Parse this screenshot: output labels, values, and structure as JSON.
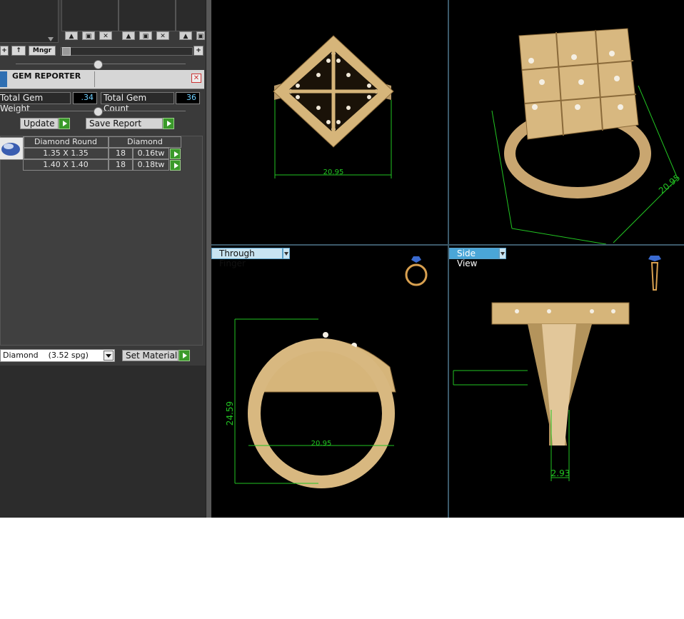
{
  "toolbar": {
    "mngr_label": "Mngr",
    "plus_label": "+",
    "slot_buttons": [
      "up-arrow",
      "save-icon",
      "delete-icon"
    ]
  },
  "gem_reporter": {
    "title": "GEM REPORTER",
    "total_weight_label": "Total Gem Weight",
    "total_weight_value": ".34",
    "total_count_label": "Total Gem Count",
    "total_count_value": "36",
    "update_label": "Update",
    "save_report_label": "Save Report",
    "table_header": [
      "Diamond Round",
      "Diamond"
    ],
    "rows": [
      {
        "size": "1.35 X 1.35",
        "count": "18",
        "weight": "0.16tw"
      },
      {
        "size": "1.40 X 1.40",
        "count": "18",
        "weight": "0.18tw"
      }
    ],
    "material_value": "Diamond    (3.52 spg)",
    "set_material_label": "Set Material"
  },
  "viewports": {
    "top": {
      "dimension": "20.95"
    },
    "perspective": {
      "dimension": "20.95"
    },
    "through_finger": {
      "tab_label": "Through Finger",
      "height": "24.59",
      "width": "20.95"
    },
    "side": {
      "tab_label": "Side View",
      "thickness": "2.93"
    }
  },
  "colors": {
    "gold": "#d8b880",
    "dimension_line": "#22c422",
    "tab_active": "#4aa6d8"
  }
}
